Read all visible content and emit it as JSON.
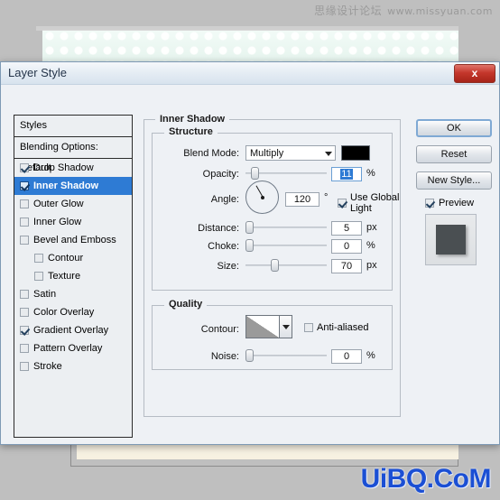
{
  "watermarks": {
    "top_cn": "思缘设计论坛",
    "top_url": "www.missyuan.com",
    "bottom": "UiBQ.CoM"
  },
  "dialog": {
    "title": "Layer Style",
    "close_label": "x"
  },
  "styles_panel": {
    "header": "Styles",
    "blending_options": "Blending Options: Default",
    "items": [
      {
        "label": "Drop Shadow",
        "checked": true,
        "selected": false,
        "indent": false
      },
      {
        "label": "Inner Shadow",
        "checked": true,
        "selected": true,
        "indent": false
      },
      {
        "label": "Outer Glow",
        "checked": false,
        "selected": false,
        "indent": false
      },
      {
        "label": "Inner Glow",
        "checked": false,
        "selected": false,
        "indent": false
      },
      {
        "label": "Bevel and Emboss",
        "checked": false,
        "selected": false,
        "indent": false
      },
      {
        "label": "Contour",
        "checked": false,
        "selected": false,
        "indent": true
      },
      {
        "label": "Texture",
        "checked": false,
        "selected": false,
        "indent": true
      },
      {
        "label": "Satin",
        "checked": false,
        "selected": false,
        "indent": false
      },
      {
        "label": "Color Overlay",
        "checked": false,
        "selected": false,
        "indent": false
      },
      {
        "label": "Gradient Overlay",
        "checked": true,
        "selected": false,
        "indent": false
      },
      {
        "label": "Pattern Overlay",
        "checked": false,
        "selected": false,
        "indent": false
      },
      {
        "label": "Stroke",
        "checked": false,
        "selected": false,
        "indent": false
      }
    ]
  },
  "inner_shadow": {
    "group_title": "Inner Shadow",
    "structure": {
      "title": "Structure",
      "blend_mode_label": "Blend Mode:",
      "blend_mode_value": "Multiply",
      "blend_color": "#000000",
      "opacity_label": "Opacity:",
      "opacity_value": "11",
      "opacity_unit": "%",
      "angle_label": "Angle:",
      "angle_value": "120",
      "angle_unit": "°",
      "use_global_light": "Use Global Light",
      "use_global_light_checked": true,
      "distance_label": "Distance:",
      "distance_value": "5",
      "distance_unit": "px",
      "choke_label": "Choke:",
      "choke_value": "0",
      "choke_unit": "%",
      "size_label": "Size:",
      "size_value": "70",
      "size_unit": "px"
    },
    "quality": {
      "title": "Quality",
      "contour_label": "Contour:",
      "anti_aliased_label": "Anti-aliased",
      "anti_aliased_checked": false,
      "noise_label": "Noise:",
      "noise_value": "0",
      "noise_unit": "%"
    }
  },
  "buttons": {
    "ok": "OK",
    "reset": "Reset",
    "new_style": "New Style...",
    "preview": "Preview",
    "preview_checked": true
  },
  "colors": {
    "selection_blue": "#2e7bd4",
    "close_red": "#c5372c",
    "watermark_blue": "#1b4fd4"
  }
}
